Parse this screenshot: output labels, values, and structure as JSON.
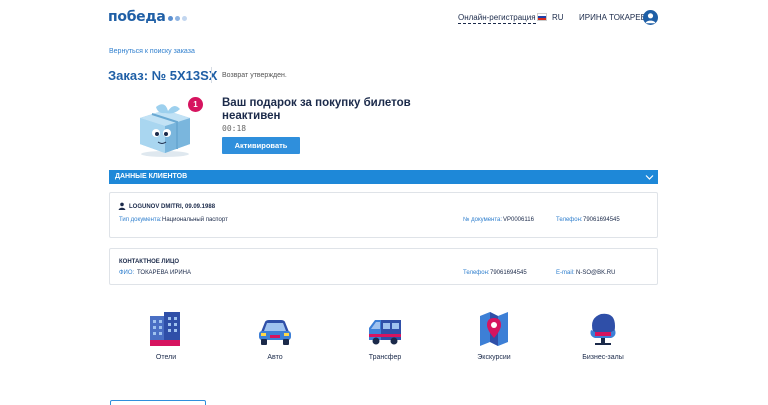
{
  "header": {
    "logo_text": "победа",
    "online_registration": "Онлайн-регистрация",
    "language": "RU",
    "user_name": "ИРИНА ТОКАРЕВА"
  },
  "order": {
    "back_link": "Вернуться к поиску заказа",
    "title": "Заказ: № 5X13SX",
    "status": "Возврат утвержден."
  },
  "gift": {
    "badge": "1",
    "title": "Ваш подарок за покупку билетов неактивен",
    "timer": "00:18",
    "activate_label": "Активировать"
  },
  "clients_section": {
    "title": "ДАННЫЕ КЛИЕНТОВ"
  },
  "passenger": {
    "name": "LOGUNOV DMITRI, 09.09.1988",
    "doc_type_label": "Тип документа:",
    "doc_type_value": "Национальный паспорт",
    "doc_number_label": "№ документа:",
    "doc_number_value": "VP0006116",
    "phone_label": "Телефон:",
    "phone_value": "79061694545"
  },
  "contact": {
    "title": "КОНТАКТНОЕ ЛИЦО",
    "name_label": "ФИО:",
    "name_value": "ТОКАРЕВА ИРИНА",
    "phone_label": "Телефон:",
    "phone_value": "79061694545",
    "email_label": "E-mail:",
    "email_value": "N-SO@BK.RU"
  },
  "services": [
    {
      "label": "Отели",
      "icon": "hotel-icon"
    },
    {
      "label": "Авто",
      "icon": "car-icon"
    },
    {
      "label": "Трансфер",
      "icon": "van-icon"
    },
    {
      "label": "Экскурсии",
      "icon": "map-pin-icon"
    },
    {
      "label": "Бизнес-залы",
      "icon": "armchair-icon"
    }
  ],
  "colors": {
    "brand_blue": "#1f5fa6",
    "accent_blue": "#1e88d8",
    "link_blue": "#2f7fce",
    "badge_pink": "#d6145f"
  }
}
